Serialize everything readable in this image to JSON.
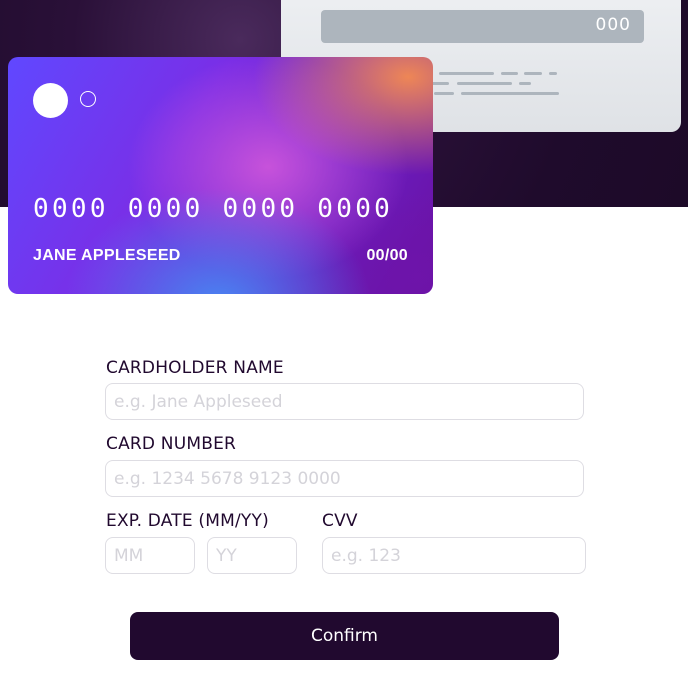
{
  "card_back": {
    "cvv": "000"
  },
  "card_front": {
    "number": "0000 0000 0000 0000",
    "name": "JANE APPLESEED",
    "expiry": "00/00"
  },
  "form": {
    "cardholder_label": "CARDHOLDER NAME",
    "cardholder_placeholder": "e.g. Jane Appleseed",
    "number_label": "CARD NUMBER",
    "number_placeholder": "e.g. 1234 5678 9123 0000",
    "exp_label": "EXP. DATE (MM/YY)",
    "month_placeholder": "MM",
    "year_placeholder": "YY",
    "cvv_label": "CVV",
    "cvv_placeholder": "e.g. 123",
    "confirm_label": "Confirm"
  },
  "colors": {
    "banner": "#1d0a28",
    "button": "#21092f",
    "input_border": "#dedde3",
    "placeholder": "#d4d3d9",
    "strip": "#adb5bd"
  }
}
